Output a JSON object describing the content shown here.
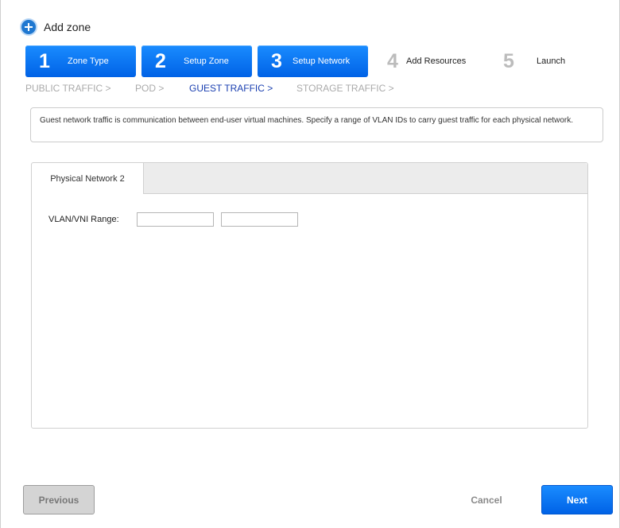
{
  "dialog": {
    "title": "Add zone",
    "icon": "add-circle-icon"
  },
  "steps": [
    {
      "number": "1",
      "label": "Zone Type",
      "state": "complete"
    },
    {
      "number": "2",
      "label": "Setup Zone",
      "state": "complete"
    },
    {
      "number": "3",
      "label": "Setup Network",
      "state": "current"
    },
    {
      "number": "4",
      "label": "Add Resources",
      "state": "pending"
    },
    {
      "number": "5",
      "label": "Launch",
      "state": "pending"
    }
  ],
  "substeps": [
    {
      "label": "PUBLIC TRAFFIC >",
      "state": "done"
    },
    {
      "label": "POD >",
      "state": "done"
    },
    {
      "label": "GUEST TRAFFIC >",
      "state": "current"
    },
    {
      "label": "STORAGE TRAFFIC >",
      "state": "pending"
    }
  ],
  "info": "Guest network traffic is communication between end-user virtual machines. Specify a range of VLAN IDs to carry guest traffic for each physical network.",
  "panel": {
    "tab_label": "Physical Network 2",
    "vlan_label": "VLAN/VNI Range:",
    "vlan_start": {
      "value": "",
      "placeholder": ""
    },
    "vlan_end": {
      "value": "",
      "placeholder": ""
    }
  },
  "buttons": {
    "previous": "Previous",
    "cancel": "Cancel",
    "next": "Next"
  },
  "colors": {
    "accent": "#0a74f0",
    "current_substep": "#1a3fb0",
    "inactive_text": "#aaaaaa"
  }
}
